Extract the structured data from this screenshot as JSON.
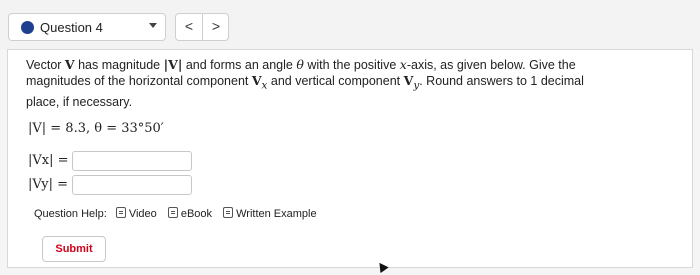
{
  "question_nav": {
    "label": "Question 4",
    "prev_glyph": "<",
    "next_glyph": ">"
  },
  "problem": {
    "stem_1": "Vector ",
    "stem_V": "V",
    "stem_2": " has magnitude ",
    "stem_absV": "|V|",
    "stem_3": " and forms an angle ",
    "stem_theta": "θ",
    "stem_4": " with the positive ",
    "stem_x": "x",
    "stem_5": "-axis, as given below. Give the magnitudes of the horizontal component ",
    "stem_Vx": "V",
    "stem_x_sub": "x",
    "stem_6": " and vertical component ",
    "stem_Vy": "V",
    "stem_y_sub": "y",
    "stem_7": ". Round answers to 1 decimal place, if necessary.",
    "given": "|V| = 8.3,  θ = 33°50′"
  },
  "answers": [
    {
      "label": "|Vx| =",
      "value": "",
      "placeholder": ""
    },
    {
      "label": "|Vy| =",
      "value": "",
      "placeholder": ""
    }
  ],
  "help": {
    "label": "Question Help:",
    "items": [
      {
        "label": "Video",
        "icon": "document-icon"
      },
      {
        "label": "eBook",
        "icon": "document-icon"
      },
      {
        "label": "Written Example",
        "icon": "document-icon"
      }
    ]
  },
  "submit_label": "Submit",
  "colors": {
    "accent": "#1c3f8f",
    "submit_text": "#d0021b"
  }
}
